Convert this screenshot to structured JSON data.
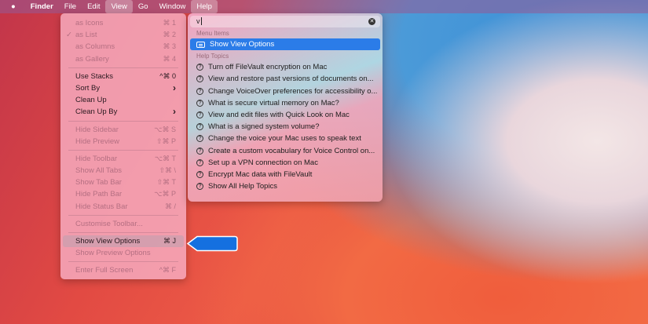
{
  "menubar": {
    "apple": "",
    "items": [
      "Finder",
      "File",
      "Edit",
      "View",
      "Go",
      "Window",
      "Help"
    ]
  },
  "view_menu": {
    "items": [
      {
        "label": "as Icons",
        "shortcut": "⌘ 1",
        "disabled": true
      },
      {
        "label": "as List",
        "shortcut": "⌘ 2",
        "disabled": true,
        "checked": true
      },
      {
        "label": "as Columns",
        "shortcut": "⌘ 3",
        "disabled": true
      },
      {
        "label": "as Gallery",
        "shortcut": "⌘ 4",
        "disabled": true
      },
      {
        "sep": true
      },
      {
        "label": "Use Stacks",
        "shortcut": "^⌘ 0"
      },
      {
        "label": "Sort By",
        "shortcut": "›"
      },
      {
        "label": "Clean Up",
        "shortcut": ""
      },
      {
        "label": "Clean Up By",
        "shortcut": "›"
      },
      {
        "sep": true
      },
      {
        "label": "Hide Sidebar",
        "shortcut": "⌥⌘ S",
        "disabled": true
      },
      {
        "label": "Hide Preview",
        "shortcut": "⇧⌘ P",
        "disabled": true
      },
      {
        "sep": true
      },
      {
        "label": "Hide Toolbar",
        "shortcut": "⌥⌘ T",
        "disabled": true
      },
      {
        "label": "Show All Tabs",
        "shortcut": "⇧⌘ \\",
        "disabled": true
      },
      {
        "label": "Show Tab Bar",
        "shortcut": "⇧⌘ T",
        "disabled": true
      },
      {
        "label": "Hide Path Bar",
        "shortcut": "⌥⌘ P",
        "disabled": true
      },
      {
        "label": "Hide Status Bar",
        "shortcut": "⌘ /",
        "disabled": true
      },
      {
        "sep": true
      },
      {
        "label": "Customise Toolbar...",
        "shortcut": "",
        "disabled": true
      },
      {
        "sep": true
      },
      {
        "label": "Show View Options",
        "shortcut": "⌘ J",
        "highlighted": true
      },
      {
        "label": "Show Preview Options",
        "shortcut": "",
        "disabled": true
      },
      {
        "sep": true
      },
      {
        "label": "Enter Full Screen",
        "shortcut": "^⌘ F",
        "disabled": true
      }
    ]
  },
  "help": {
    "search_value": "v",
    "menu_items_header": "Menu Items",
    "menu_items": [
      "Show View Options"
    ],
    "help_topics_header": "Help Topics",
    "topics": [
      "Turn off FileVault encryption on Mac",
      "View and restore past versions of documents on...",
      "Change VoiceOver preferences for accessibility o...",
      "What is secure virtual memory on Mac?",
      "View and edit files with Quick Look on Mac",
      "What is a signed system volume?",
      "Change the voice your Mac uses to speak text",
      "Create a custom vocabulary for Voice Control on...",
      "Set up a VPN connection on Mac",
      "Encrypt Mac data with FileVault",
      "Show All Help Topics"
    ]
  },
  "colors": {
    "selection": "#2b7ce8",
    "arrow": "#1570e0"
  }
}
